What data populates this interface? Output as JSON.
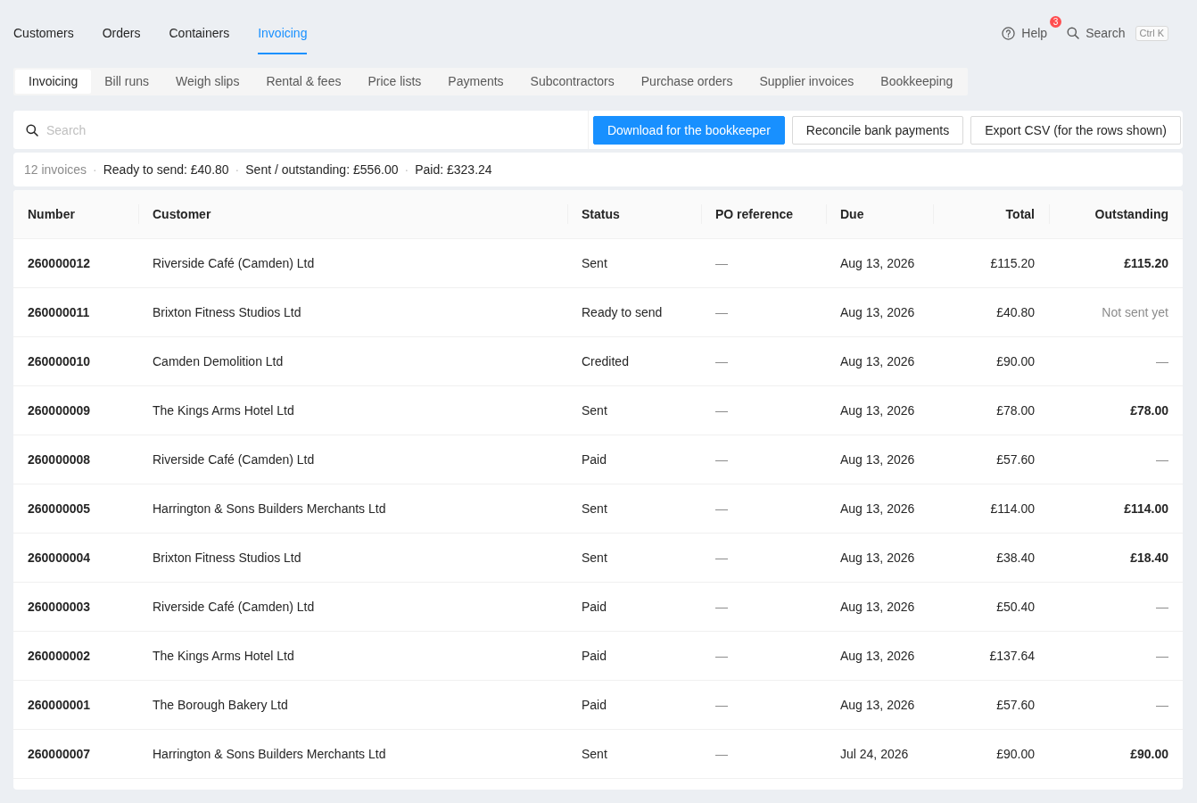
{
  "main_nav": [
    {
      "label": "Customers",
      "selected": false
    },
    {
      "label": "Orders",
      "selected": false
    },
    {
      "label": "Containers",
      "selected": false
    },
    {
      "label": "Invoicing",
      "selected": true
    }
  ],
  "header_tools": {
    "help": {
      "label": "Help",
      "badge": "3"
    },
    "search": {
      "label": "Search",
      "shortcut": "Ctrl K"
    }
  },
  "sub_tabs": [
    {
      "label": "Invoicing",
      "selected": true
    },
    {
      "label": "Bill runs",
      "selected": false
    },
    {
      "label": "Weigh slips",
      "selected": false
    },
    {
      "label": "Rental & fees",
      "selected": false
    },
    {
      "label": "Price lists",
      "selected": false
    },
    {
      "label": "Payments",
      "selected": false
    },
    {
      "label": "Subcontractors",
      "selected": false
    },
    {
      "label": "Purchase orders",
      "selected": false
    },
    {
      "label": "Supplier invoices",
      "selected": false
    },
    {
      "label": "Bookkeeping",
      "selected": false
    }
  ],
  "toolbar": {
    "search": {
      "placeholder": "Search"
    },
    "buttons": [
      {
        "label": "Download for the bookkeeper",
        "kind": "primary"
      },
      {
        "label": "Reconcile bank payments",
        "kind": "default"
      },
      {
        "label": "Export CSV (for the rows shown)",
        "kind": "default"
      }
    ]
  },
  "summary": [
    {
      "text": "12 invoices",
      "kind": "count"
    },
    {
      "text": "·",
      "kind": "separator"
    },
    {
      "text": "Ready to send: £40.80",
      "kind": "figure"
    },
    {
      "text": "·",
      "kind": "separator"
    },
    {
      "text": "Sent / outstanding: £556.00",
      "kind": "figure"
    },
    {
      "text": "·",
      "kind": "separator"
    },
    {
      "text": "Paid: £323.24",
      "kind": "figure"
    }
  ],
  "table": {
    "columns": [
      "Number",
      "Customer",
      "Status",
      "PO reference",
      "Due",
      "Total",
      "Outstanding"
    ],
    "rows": [
      {
        "number": "260000012",
        "customer": "Riverside Café (Camden) Ltd",
        "status": "Sent",
        "po_reference": "—",
        "due": "Aug 13, 2026",
        "total": "£115.20",
        "outstanding": {
          "text": "£115.20",
          "kind": "amount"
        }
      },
      {
        "number": "260000011",
        "customer": "Brixton Fitness Studios Ltd",
        "status": "Ready to send",
        "po_reference": "—",
        "due": "Aug 13, 2026",
        "total": "£40.80",
        "outstanding": {
          "text": "Not sent yet",
          "kind": "note"
        }
      },
      {
        "number": "260000010",
        "customer": "Camden Demolition Ltd",
        "status": "Credited",
        "po_reference": "—",
        "due": "Aug 13, 2026",
        "total": "£90.00",
        "outstanding": {
          "text": "—",
          "kind": "none"
        }
      },
      {
        "number": "260000009",
        "customer": "The Kings Arms Hotel Ltd",
        "status": "Sent",
        "po_reference": "—",
        "due": "Aug 13, 2026",
        "total": "£78.00",
        "outstanding": {
          "text": "£78.00",
          "kind": "amount"
        }
      },
      {
        "number": "260000008",
        "customer": "Riverside Café (Camden) Ltd",
        "status": "Paid",
        "po_reference": "—",
        "due": "Aug 13, 2026",
        "total": "£57.60",
        "outstanding": {
          "text": "—",
          "kind": "none"
        }
      },
      {
        "number": "260000005",
        "customer": "Harrington & Sons Builders Merchants Ltd",
        "status": "Sent",
        "po_reference": "—",
        "due": "Aug 13, 2026",
        "total": "£114.00",
        "outstanding": {
          "text": "£114.00",
          "kind": "amount"
        }
      },
      {
        "number": "260000004",
        "customer": "Brixton Fitness Studios Ltd",
        "status": "Sent",
        "po_reference": "—",
        "due": "Aug 13, 2026",
        "total": "£38.40",
        "outstanding": {
          "text": "£18.40",
          "kind": "amount"
        }
      },
      {
        "number": "260000003",
        "customer": "Riverside Café (Camden) Ltd",
        "status": "Paid",
        "po_reference": "—",
        "due": "Aug 13, 2026",
        "total": "£50.40",
        "outstanding": {
          "text": "—",
          "kind": "none"
        }
      },
      {
        "number": "260000002",
        "customer": "The Kings Arms Hotel Ltd",
        "status": "Paid",
        "po_reference": "—",
        "due": "Aug 13, 2026",
        "total": "£137.64",
        "outstanding": {
          "text": "—",
          "kind": "none"
        }
      },
      {
        "number": "260000001",
        "customer": "The Borough Bakery Ltd",
        "status": "Paid",
        "po_reference": "—",
        "due": "Aug 13, 2026",
        "total": "£57.60",
        "outstanding": {
          "text": "—",
          "kind": "none"
        }
      },
      {
        "number": "260000007",
        "customer": "Harrington & Sons Builders Merchants Ltd",
        "status": "Sent",
        "po_reference": "—",
        "due": "Jul 24, 2026",
        "total": "£90.00",
        "outstanding": {
          "text": "£90.00",
          "kind": "amount"
        }
      }
    ]
  }
}
